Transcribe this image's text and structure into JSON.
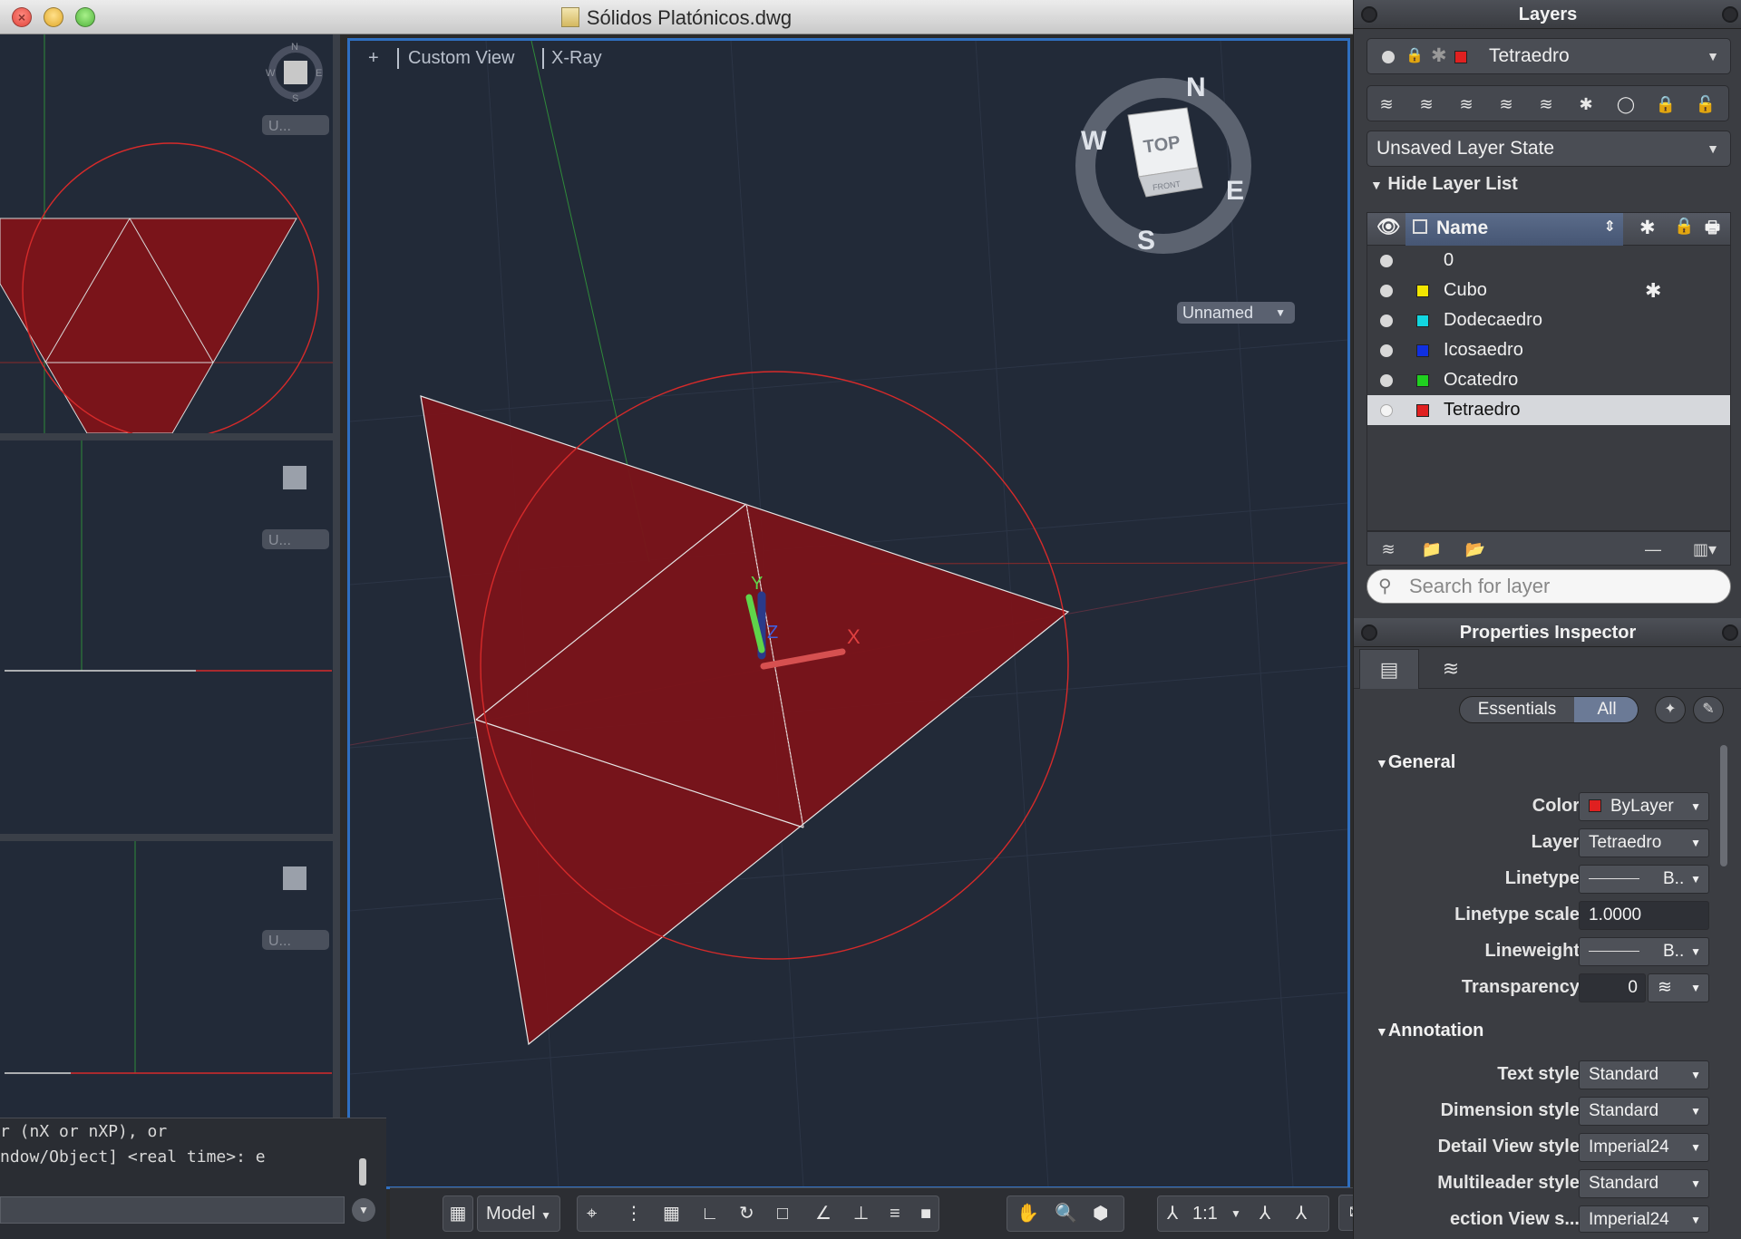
{
  "window": {
    "title": "Sólidos Platónicos.dwg"
  },
  "icons": {
    "close": "close-icon",
    "minimize": "minimize-icon",
    "maximize": "maximize-icon"
  },
  "viewport": {
    "plus": "+",
    "view_name": "Custom View",
    "visual_style": "X-Ray",
    "viewcube": {
      "face": "TOP",
      "front": "FRONT",
      "n": "N",
      "s": "S",
      "e": "E",
      "w": "W"
    },
    "ucs_name": "Unnamed",
    "axis_x": "X",
    "axis_y": "Y",
    "axis_z": "Z"
  },
  "small_viewports": {
    "vp1_n": "N",
    "vp1_s": "S",
    "vp1_e": "E",
    "vp1_w": "W",
    "ucs_label": "U..."
  },
  "command_line": {
    "line1": "r (nX or nXP), or",
    "line2": "ndow/Object] <real time>: e",
    "input": ""
  },
  "statusbar": {
    "model": "Model",
    "scale": "1:1"
  },
  "layers_panel": {
    "title": "Layers",
    "current_layer": "Tetraedro",
    "current_color": "#e02020",
    "layer_state": "Unsaved Layer State",
    "hide_list": "Hide Layer List",
    "name_col": "Name",
    "layers": [
      {
        "name": "0",
        "color": "",
        "frozen": ""
      },
      {
        "name": "Cubo",
        "color": "#f2e600",
        "frozen": "✱"
      },
      {
        "name": "Dodecaedro",
        "color": "#12d6e0",
        "frozen": ""
      },
      {
        "name": "Icosaedro",
        "color": "#1030e0",
        "frozen": ""
      },
      {
        "name": "Ocatedro",
        "color": "#20d020",
        "frozen": ""
      },
      {
        "name": "Tetraedro",
        "color": "#e02020",
        "frozen": ""
      }
    ],
    "search_placeholder": "Search for layer"
  },
  "properties": {
    "title": "Properties Inspector",
    "seg_essentials": "Essentials",
    "seg_all": "All",
    "general": "General",
    "annotation": "Annotation",
    "color_label": "Color",
    "color_value": "ByLayer",
    "color_swatch": "#e02020",
    "layer_label": "Layer",
    "layer_value": "Tetraedro",
    "linetype_label": "Linetype",
    "linetype_value": "B..",
    "ltscale_label": "Linetype scale",
    "ltscale_value": "1.0000",
    "lineweight_label": "Lineweight",
    "lineweight_value": "B..",
    "transparency_label": "Transparency",
    "transparency_value": "0",
    "textstyle_label": "Text style",
    "textstyle_value": "Standard",
    "dimstyle_label": "Dimension style",
    "dimstyle_value": "Standard",
    "detailview_label": "Detail View style",
    "detailview_value": "Imperial24",
    "mleader_label": "Multileader style",
    "mleader_value": "Standard",
    "sectionview_label": "ection View s...",
    "sectionview_value": "Imperial24"
  }
}
